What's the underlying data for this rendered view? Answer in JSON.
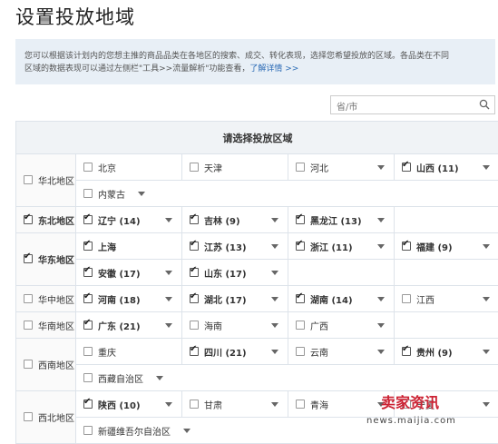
{
  "page_title": "设置投放地域",
  "notice": {
    "text1": "您可以根据该计划内的您想主推的商品品类在各地区的搜索、成交、转化表现，选择您希望投放的区域。各品类在不同",
    "text2": "区域的数据表现可以通过左侧栏\"工具>>流量解析\"功能查看，",
    "link": "了解详情 >>"
  },
  "search": {
    "placeholder": "省/市"
  },
  "table_header": "请选择投放区域",
  "regions": [
    {
      "name": "华北地区",
      "checked": false,
      "provinces": [
        {
          "name": "北京",
          "checked": false,
          "dropdown": false
        },
        {
          "name": "天津",
          "checked": false,
          "dropdown": false
        },
        {
          "name": "河北",
          "checked": false,
          "dropdown": true
        },
        {
          "name": "山西 (11)",
          "checked": true,
          "dropdown": true
        },
        {
          "name": "内蒙古",
          "checked": false,
          "dropdown": true
        }
      ]
    },
    {
      "name": "东北地区",
      "checked": true,
      "provinces": [
        {
          "name": "辽宁 (14)",
          "checked": true,
          "dropdown": true
        },
        {
          "name": "吉林 (9)",
          "checked": true,
          "dropdown": true
        },
        {
          "name": "黑龙江 (13)",
          "checked": true,
          "dropdown": true
        }
      ]
    },
    {
      "name": "华东地区",
      "checked": true,
      "provinces": [
        {
          "name": "上海",
          "checked": true,
          "dropdown": false
        },
        {
          "name": "江苏 (13)",
          "checked": true,
          "dropdown": true
        },
        {
          "name": "浙江 (11)",
          "checked": true,
          "dropdown": true
        },
        {
          "name": "福建 (9)",
          "checked": true,
          "dropdown": true
        },
        {
          "name": "安徽 (17)",
          "checked": true,
          "dropdown": true
        },
        {
          "name": "山东 (17)",
          "checked": true,
          "dropdown": true
        }
      ]
    },
    {
      "name": "华中地区",
      "checked": false,
      "provinces": [
        {
          "name": "河南 (18)",
          "checked": true,
          "dropdown": true
        },
        {
          "name": "湖北 (17)",
          "checked": true,
          "dropdown": true
        },
        {
          "name": "湖南 (14)",
          "checked": true,
          "dropdown": true
        },
        {
          "name": "江西",
          "checked": false,
          "dropdown": true
        }
      ]
    },
    {
      "name": "华南地区",
      "checked": false,
      "provinces": [
        {
          "name": "广东 (21)",
          "checked": true,
          "dropdown": true
        },
        {
          "name": "海南",
          "checked": false,
          "dropdown": true
        },
        {
          "name": "广西",
          "checked": false,
          "dropdown": true
        }
      ]
    },
    {
      "name": "西南地区",
      "checked": false,
      "provinces": [
        {
          "name": "重庆",
          "checked": false,
          "dropdown": false
        },
        {
          "name": "四川 (21)",
          "checked": true,
          "dropdown": true
        },
        {
          "name": "云南",
          "checked": false,
          "dropdown": true
        },
        {
          "name": "贵州 (9)",
          "checked": true,
          "dropdown": true
        },
        {
          "name": "西藏自治区",
          "checked": false,
          "dropdown": true
        }
      ]
    },
    {
      "name": "西北地区",
      "checked": false,
      "provinces": [
        {
          "name": "陕西 (10)",
          "checked": true,
          "dropdown": true
        },
        {
          "name": "甘肃",
          "checked": false,
          "dropdown": true
        },
        {
          "name": "青海",
          "checked": false,
          "dropdown": true
        },
        {
          "name": "宁夏",
          "checked": false,
          "dropdown": true
        },
        {
          "name": "新疆维吾尔自治区",
          "checked": false,
          "dropdown": true
        }
      ]
    }
  ],
  "watermark": {
    "brand": "卖家资讯",
    "url": "news.maijia.com"
  },
  "colors": {
    "notice_bg": "#e8eff6",
    "link": "#2a6ab5",
    "border": "#dde3ea"
  }
}
